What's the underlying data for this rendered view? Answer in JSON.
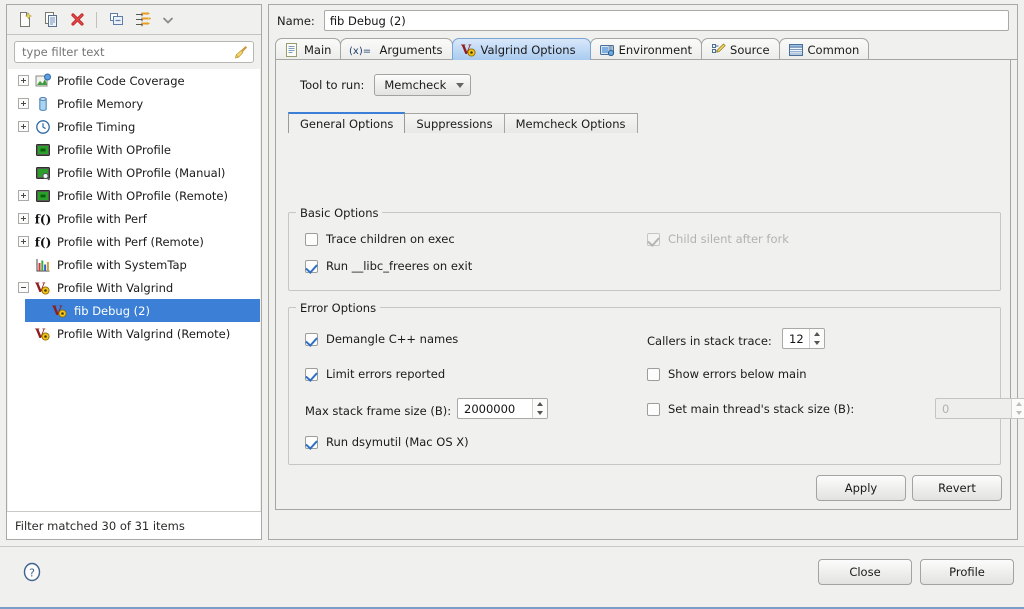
{
  "toolbar": {
    "buttons": [
      {
        "name": "new-launch-configuration",
        "icon": "new-document-icon"
      },
      {
        "name": "duplicate-launch-configuration",
        "icon": "copy-document-icon"
      },
      {
        "name": "delete-launch-configuration",
        "icon": "delete-red-x-icon"
      },
      {
        "name": "collapse-all",
        "icon": "collapse-all-icon"
      },
      {
        "name": "filter-launch-configurations",
        "icon": "filter-arrows-icon"
      },
      {
        "name": "view-menu",
        "icon": "chevron-down-icon"
      }
    ]
  },
  "filter": {
    "placeholder": "type filter text",
    "value": "",
    "clear_icon": "broom-icon"
  },
  "tree": {
    "items": [
      {
        "label": "Profile Code Coverage",
        "expander": "plus",
        "icon": "code-coverage-icon",
        "indent": 0,
        "selected": false
      },
      {
        "label": "Profile Memory",
        "expander": "plus",
        "icon": "memory-cylinder-icon",
        "indent": 0,
        "selected": false
      },
      {
        "label": "Profile Timing",
        "expander": "plus",
        "icon": "clock-icon",
        "indent": 0,
        "selected": false
      },
      {
        "label": "Profile With OProfile",
        "expander": "none",
        "icon": "oprofile-icon",
        "indent": 0,
        "selected": false
      },
      {
        "label": "Profile With OProfile (Manual)",
        "expander": "none",
        "icon": "oprofile-manual-icon",
        "indent": 0,
        "selected": false
      },
      {
        "label": "Profile With OProfile (Remote)",
        "expander": "plus",
        "icon": "oprofile-icon",
        "indent": 0,
        "selected": false
      },
      {
        "label": "Profile with Perf",
        "expander": "plus",
        "icon": "perf-fx-icon",
        "indent": 0,
        "selected": false
      },
      {
        "label": "Profile with Perf (Remote)",
        "expander": "plus",
        "icon": "perf-fx-icon",
        "indent": 0,
        "selected": false
      },
      {
        "label": "Profile with SystemTap",
        "expander": "none",
        "icon": "systemtap-chart-icon",
        "indent": 0,
        "selected": false
      },
      {
        "label": "Profile With Valgrind",
        "expander": "minus",
        "icon": "valgrind-icon",
        "indent": 0,
        "selected": false
      },
      {
        "label": "fib Debug (2)",
        "expander": "none",
        "icon": "valgrind-icon",
        "indent": 1,
        "selected": true
      },
      {
        "label": "Profile With Valgrind (Remote)",
        "expander": "none",
        "icon": "valgrind-icon",
        "indent": 0,
        "selected": false
      }
    ],
    "status": "Filter matched 30 of 31 items"
  },
  "config": {
    "name_label": "Name:",
    "name_value": "fib Debug (2)",
    "tabs": [
      {
        "label": "Main",
        "icon": "main-document-icon",
        "active": false
      },
      {
        "label": "Arguments",
        "icon": "arguments-variable-icon",
        "active": false
      },
      {
        "label": "Valgrind Options",
        "icon": "valgrind-icon",
        "active": true
      },
      {
        "label": "Environment",
        "icon": "environment-icon",
        "active": false
      },
      {
        "label": "Source",
        "icon": "source-icon",
        "active": false
      },
      {
        "label": "Common",
        "icon": "common-table-icon",
        "active": false
      }
    ]
  },
  "valgrind": {
    "tool_label": "Tool to run:",
    "tool_value": "Memcheck",
    "inner_tabs": [
      {
        "label": "General Options",
        "active": true
      },
      {
        "label": "Suppressions",
        "active": false
      },
      {
        "label": "Memcheck Options",
        "active": false
      }
    ],
    "basic_options": {
      "title": "Basic Options",
      "trace_children": {
        "label": "Trace children on exec",
        "checked": false,
        "enabled": true
      },
      "child_silent": {
        "label": "Child silent after fork",
        "checked": true,
        "enabled": false
      },
      "libc_freeres": {
        "label": "Run __libc_freeres on exit",
        "checked": true,
        "enabled": true
      }
    },
    "error_options": {
      "title": "Error Options",
      "demangle": {
        "label": "Demangle C++ names",
        "checked": true,
        "enabled": true
      },
      "limit_errors": {
        "label": "Limit errors reported",
        "checked": true,
        "enabled": true
      },
      "max_stack_frame": {
        "label": "Max stack frame size (B):",
        "value": "2000000"
      },
      "run_dsymutil": {
        "label": "Run dsymutil (Mac OS X)",
        "checked": true,
        "enabled": true
      },
      "callers": {
        "label": "Callers in stack trace:",
        "value": "12"
      },
      "show_below_main": {
        "label": "Show errors below main",
        "checked": false,
        "enabled": true
      },
      "main_stack_size": {
        "label": "Set main thread's stack size (B):",
        "checked": false,
        "enabled": false,
        "value": "0"
      }
    }
  },
  "footer": {
    "apply_label": "Apply",
    "revert_label": "Revert",
    "close_label": "Close",
    "profile_label": "Profile",
    "help_icon": "help-question-icon"
  }
}
